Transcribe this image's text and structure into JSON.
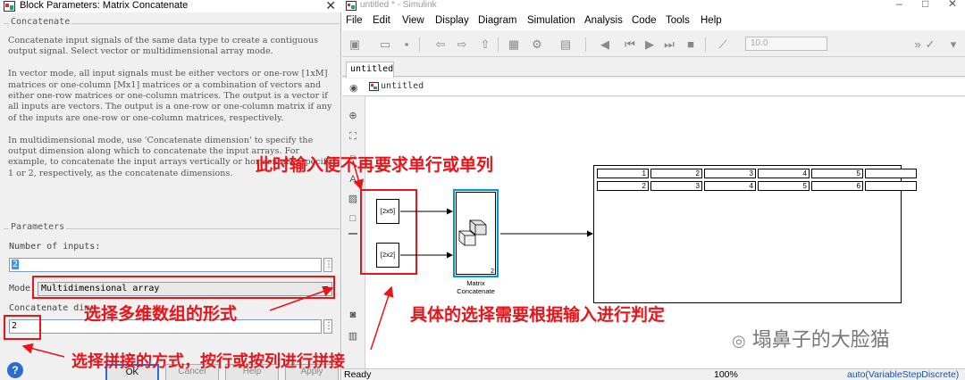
{
  "dialog": {
    "title": "Block Parameters: Matrix Concatenate",
    "section_title": "Concatenate",
    "description": [
      "Concatenate input signals of the same data type to create a contiguous output signal. Select vector or multidimensional array mode.",
      "In vector mode, all input signals must be either vectors or one-row [1xM] matrices or one-column [Mx1] matrices or a combination of vectors and either one-row matrices or one-column matrices. The output is a vector if all inputs are vectors. The output is a one-row or one-column matrix if any of the inputs are one-row or one-column matrices, respectively.",
      "In multidimensional mode, use 'Concatenate dimension' to specify the output dimension along which to concatenate the input arrays. For example, to concatenate the input arrays vertically or horizontally, specify 1 or 2, respectively, as the concatenate dimensions."
    ],
    "params_title": "Parameters",
    "num_inputs_label": "Number of inputs:",
    "num_inputs_value": "2",
    "mode_label": "Mode",
    "mode_value": "Multidimensional array",
    "concat_dim_label": "Concatenate dim",
    "concat_dim_value": "2",
    "buttons": {
      "ok": "OK",
      "cancel": "Cancel",
      "help": "Help",
      "apply": "Apply"
    },
    "help_icon": "?"
  },
  "simulink": {
    "window_title": "untitled * - Simulink",
    "window_controls": [
      "–",
      "□",
      "✕"
    ],
    "menu": [
      "File",
      "Edit",
      "View",
      "Display",
      "Diagram",
      "Simulation",
      "Analysis",
      "Code",
      "Tools",
      "Help"
    ],
    "stop_time": "10.0",
    "tab": "untitled",
    "breadcrumb": "untitled",
    "blocks": {
      "const1": "[2x5]",
      "const2": "[2x2]",
      "concat_port_count": "2",
      "concat_label_line1": "Matrix",
      "concat_label_line2": "Concatenate"
    },
    "display": {
      "row1": [
        "1",
        "2",
        "3",
        "4",
        "5",
        ""
      ],
      "row2": [
        "2",
        "3",
        "4",
        "5",
        "6",
        ""
      ]
    },
    "status": {
      "left": "Ready",
      "zoom": "100%",
      "solver": "auto(VariableStepDiscrete)"
    }
  },
  "annotations": {
    "a1": "此时输入便不再要求单行或单列",
    "a2": "选择多维数组的形式",
    "a3": "具体的选择需要根据输入进行判定",
    "a4": "选择拼接的方式，按行或按列进行拼接"
  },
  "watermark": "塌鼻子的大脸猫",
  "colors": {
    "annotation_red": "#e8141a",
    "block_blue": "#0096d6",
    "selection_blue": "#3399ff"
  }
}
